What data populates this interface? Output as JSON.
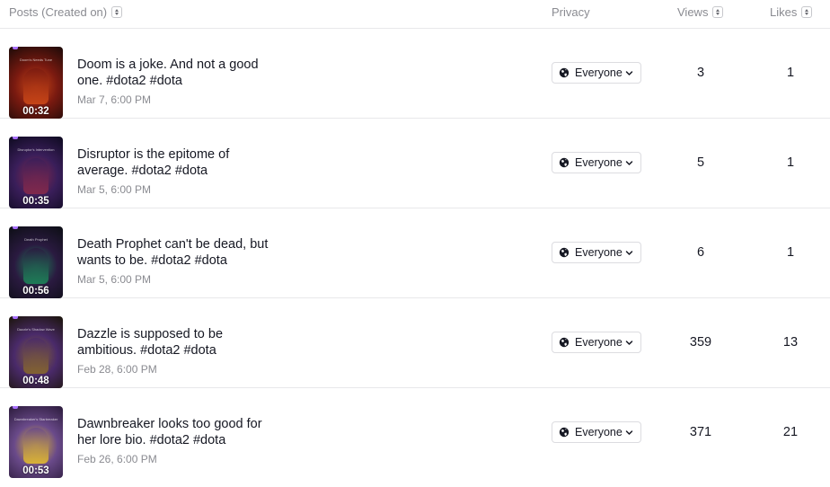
{
  "header": {
    "posts_label": "Posts (Created on)",
    "privacy_label": "Privacy",
    "views_label": "Views",
    "likes_label": "Likes"
  },
  "rows": [
    {
      "title": "Doom is a joke. And not a good one. #dota2 #dota",
      "date": "Mar 7, 6:00 PM",
      "duration": "00:32",
      "privacy": "Everyone",
      "views": "3",
      "likes": "1",
      "thumb_colors": [
        "#1a0a08",
        "#7a1a10",
        "#d04a18"
      ],
      "thumb_caption": "Doom's Needs Tune"
    },
    {
      "title": "Disruptor is the epitome of average. #dota2 #dota",
      "date": "Mar 5, 6:00 PM",
      "duration": "00:35",
      "privacy": "Everyone",
      "views": "5",
      "likes": "1",
      "thumb_colors": [
        "#0d0a1f",
        "#3a1e5a",
        "#8a2a4a"
      ],
      "thumb_caption": "Disruptor's Intervention"
    },
    {
      "title": "Death Prophet can't be dead, but wants to be. #dota2 #dota",
      "date": "Mar 5, 6:00 PM",
      "duration": "00:56",
      "privacy": "Everyone",
      "views": "6",
      "likes": "1",
      "thumb_colors": [
        "#0c0e14",
        "#2a1a40",
        "#1c8a5a"
      ],
      "thumb_caption": "Death Prophet"
    },
    {
      "title": "Dazzle is supposed to be ambitious. #dota2 #dota",
      "date": "Feb 28, 6:00 PM",
      "duration": "00:48",
      "privacy": "Everyone",
      "views": "359",
      "likes": "13",
      "thumb_colors": [
        "#1a1408",
        "#4a2a6a",
        "#8a6a2a"
      ],
      "thumb_caption": "Dazzle's Shadow Wave"
    },
    {
      "title": "Dawnbreaker looks too good for her lore bio. #dota2 #dota",
      "date": "Feb 26, 6:00 PM",
      "duration": "00:53",
      "privacy": "Everyone",
      "views": "371",
      "likes": "21",
      "thumb_colors": [
        "#2a1a3a",
        "#6a4a8a",
        "#e8c02a"
      ],
      "thumb_caption": "Dawnbreaker's Starbreaker"
    }
  ],
  "icons": {
    "globe": "globe-icon",
    "chevron": "chevron-down-icon",
    "sort": "sort-icon"
  }
}
